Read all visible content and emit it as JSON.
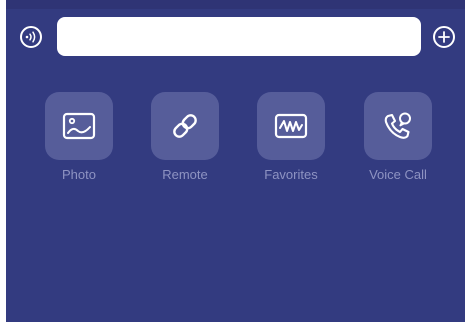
{
  "composer": {
    "input_value": "",
    "input_placeholder": "",
    "voice_icon": "voice-input-icon",
    "add_icon": "plus-circle-icon"
  },
  "actions": [
    {
      "label": "Photo",
      "icon": "photo-icon"
    },
    {
      "label": "Remote",
      "icon": "link-icon"
    },
    {
      "label": "Favorites",
      "icon": "waveform-icon"
    },
    {
      "label": "Voice Call",
      "icon": "phone-icon"
    }
  ],
  "colors": {
    "panel_background": "#333b80",
    "tile_background": "#565d9a",
    "label_text": "#8e93c2",
    "icon": "#ffffff"
  }
}
